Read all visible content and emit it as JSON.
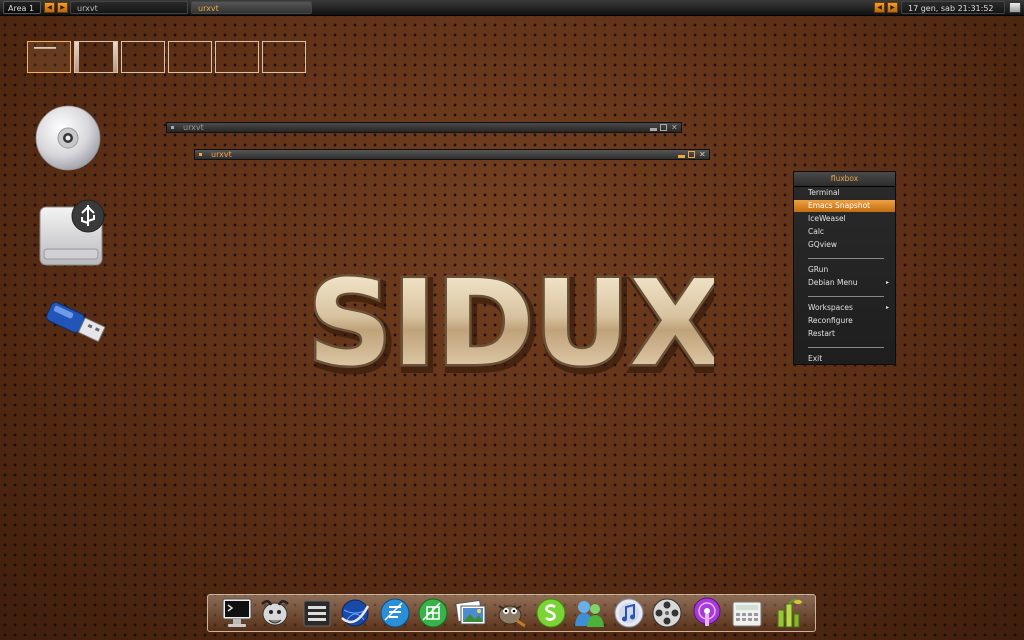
{
  "toolbar": {
    "workspace_label": "Area 1",
    "task_inactive": "urxvt",
    "task_active": "urxvt",
    "clock": "17 gen, sab 21:31:52",
    "arrow_left": "◀",
    "arrow_right": "▶"
  },
  "pager": {
    "workspaces": 6,
    "active_index": 0
  },
  "desktop_icons": [
    "cd-drive-icon",
    "usb-storage-drive-icon",
    "usb-flash-drive-icon"
  ],
  "windows": [
    {
      "title": "urxvt",
      "state": "inactive"
    },
    {
      "title": "urxvt",
      "state": "active"
    }
  ],
  "menu": {
    "title": "fluxbox",
    "items": [
      "Terminal",
      "Emacs Snapshot",
      "IceWeasel",
      "Calc",
      "GQview",
      "GRun",
      "Debian Menu",
      "Workspaces",
      "Reconfigure",
      "Restart",
      "Exit"
    ],
    "selected_item": "Emacs Snapshot",
    "submenu_arrow": "▸"
  },
  "logo_text": "SIDUX",
  "dock_icons": [
    "terminal-icon",
    "gnu-gnome-icon",
    "file-manager-icon",
    "browser-globe-icon",
    "writer-icon",
    "calc-icon",
    "image-viewer-icon",
    "gimp-icon",
    "skype-icon",
    "messenger-icon",
    "music-player-icon",
    "video-player-icon",
    "podcast-icon",
    "calculator-icon",
    "bamboo-icon"
  ],
  "colors": {
    "accent": "#f0a040",
    "menu_bg": "#242424",
    "desktop_bg": "#5a2d14"
  }
}
